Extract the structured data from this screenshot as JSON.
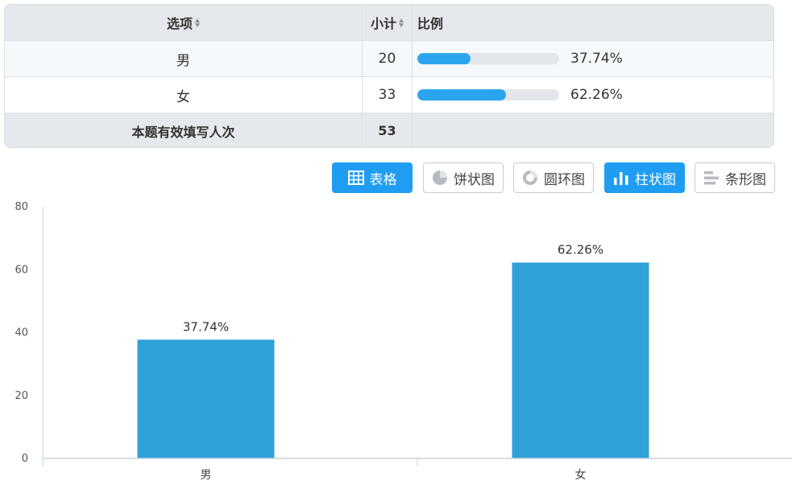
{
  "table": {
    "header": {
      "option": "选项",
      "count": "小计",
      "ratio": "比例"
    },
    "rows": [
      {
        "option": "男",
        "count": "20",
        "percent": "37.74%",
        "fraction": 0.3774
      },
      {
        "option": "女",
        "count": "33",
        "percent": "62.26%",
        "fraction": 0.6226
      }
    ],
    "total": {
      "label": "本题有效填写人次",
      "count": "53"
    }
  },
  "toolbar": {
    "buttons": [
      {
        "label": "表格",
        "icon": "table-icon",
        "active": true
      },
      {
        "label": "饼状图",
        "icon": "pie-icon",
        "active": false
      },
      {
        "label": "圆环图",
        "icon": "donut-icon",
        "active": false
      },
      {
        "label": "柱状图",
        "icon": "bar-chart-icon",
        "active": true
      },
      {
        "label": "条形图",
        "icon": "hbar-icon",
        "active": false
      }
    ]
  },
  "colors": {
    "accent": "#1e9df2",
    "bar": "#2fa1d9",
    "progress": "#2ba6ee"
  },
  "chart_data": {
    "type": "bar",
    "categories": [
      "男",
      "女"
    ],
    "values": [
      37.74,
      62.26
    ],
    "data_labels": [
      "37.74%",
      "62.26%"
    ],
    "ylim": [
      0,
      80
    ],
    "yticks": [
      0,
      20,
      40,
      60,
      80
    ],
    "grid": false
  }
}
